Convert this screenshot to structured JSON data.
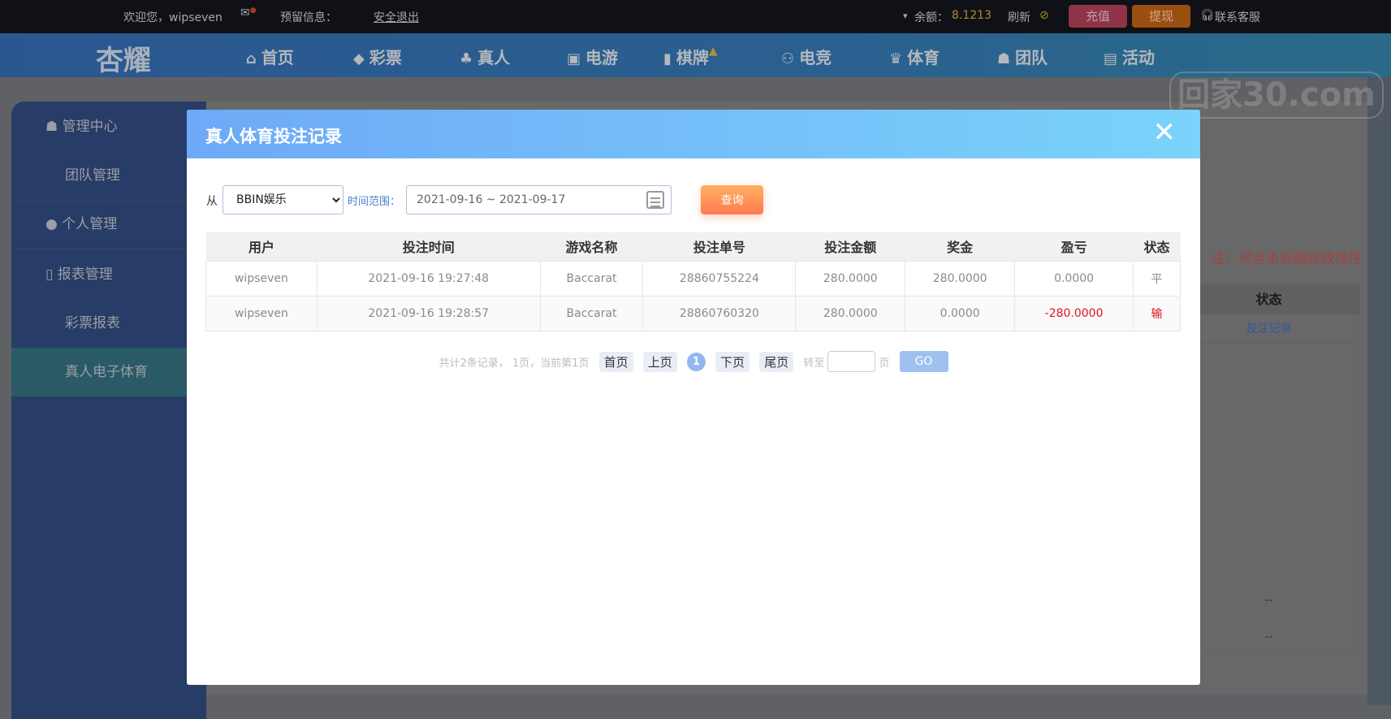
{
  "topbar": {
    "welcome": "欢迎您，wipseven",
    "reserved_info": "预留信息：",
    "logout": "安全退出",
    "balance_label": "余额：",
    "balance": "8.1213",
    "refresh": "刷新",
    "recharge": "充值",
    "withdraw": "提现",
    "support": "联系客服"
  },
  "nav": {
    "logo": "杏耀",
    "items": [
      "首页",
      "彩票",
      "真人",
      "电游",
      "棋牌",
      "电竞",
      "体育",
      "团队",
      "活动"
    ]
  },
  "sidebar": {
    "items": [
      "管理中心",
      "团队管理",
      "个人管理",
      "报表管理",
      "彩票报表",
      "真人电子体育"
    ]
  },
  "background": {
    "note": "注：可点击标题修改排序",
    "col_status": "状态",
    "link": "投注记录",
    "dash1": "--",
    "dash2": "--"
  },
  "watermark": "回家30.com",
  "modal": {
    "title": "真人体育投注记录",
    "from_label": "从",
    "platform": "BBIN娱乐",
    "range_label": "时间范围：",
    "date_range": "2021-09-16 ~ 2021-09-17",
    "query": "查询",
    "columns": [
      "用户",
      "投注时间",
      "游戏名称",
      "投注单号",
      "投注金额",
      "奖金",
      "盈亏",
      "状态"
    ],
    "rows": [
      [
        "wipseven",
        "2021-09-16 19:27:48",
        "Baccarat",
        "28860755224",
        "280.0000",
        "280.0000",
        "0.0000",
        "平"
      ],
      [
        "wipseven",
        "2021-09-16 19:28:57",
        "Baccarat",
        "28860760320",
        "280.0000",
        "0.0000",
        "-280.0000",
        "输"
      ]
    ],
    "pager": {
      "summary": "共计2条记录， 1页，当前第1页",
      "first": "首页",
      "prev": "上页",
      "current": "1",
      "next": "下页",
      "last": "尾页",
      "goto": "转至",
      "page": "页",
      "go": "GO"
    }
  }
}
